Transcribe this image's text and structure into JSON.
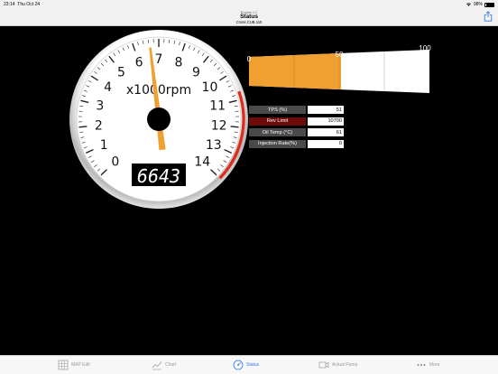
{
  "status_bar": {
    "time": "23:14",
    "date": "Thu Oct 24",
    "battery": "98%"
  },
  "nav": {
    "subtitle": "Engine LC",
    "title": "Status",
    "device": "Cross CUB 110"
  },
  "tachometer": {
    "unit_label": "x1000rpm",
    "tick_labels": [
      "0",
      "1",
      "2",
      "3",
      "4",
      "5",
      "6",
      "7",
      "8",
      "9",
      "10",
      "11",
      "12",
      "13",
      "14"
    ],
    "digital_value": "6643",
    "needle_rpm": 6643,
    "max_rpm": 14000,
    "redline_start_rpm": 10700
  },
  "throttle_meter": {
    "scale_labels": [
      "0",
      "50",
      "100"
    ],
    "value_percent": 51,
    "fill_color": "#f0a030"
  },
  "readings": [
    {
      "label": "TPS (%)",
      "value": "51",
      "highlight": false
    },
    {
      "label": "Rev Limit",
      "value": "10700",
      "highlight": true
    },
    {
      "label": "Oil Temp (°C)",
      "value": "61",
      "highlight": false
    },
    {
      "label": "Injection Rate(%)",
      "value": "0",
      "highlight": false
    }
  ],
  "tabs": [
    {
      "label": "MAP Edit",
      "icon": "grid-icon",
      "active": false
    },
    {
      "label": "Chart",
      "icon": "chart-icon",
      "active": false
    },
    {
      "label": "Status",
      "icon": "gauge-icon",
      "active": true
    },
    {
      "label": "Actual Pump",
      "icon": "pump-icon",
      "active": false
    },
    {
      "label": "More",
      "icon": "more-icon",
      "active": false
    }
  ],
  "colors": {
    "accent": "#2f7ddc",
    "needle": "#f0a030",
    "redline": "#e02a1a",
    "warn_label": "#6d0a0a"
  }
}
